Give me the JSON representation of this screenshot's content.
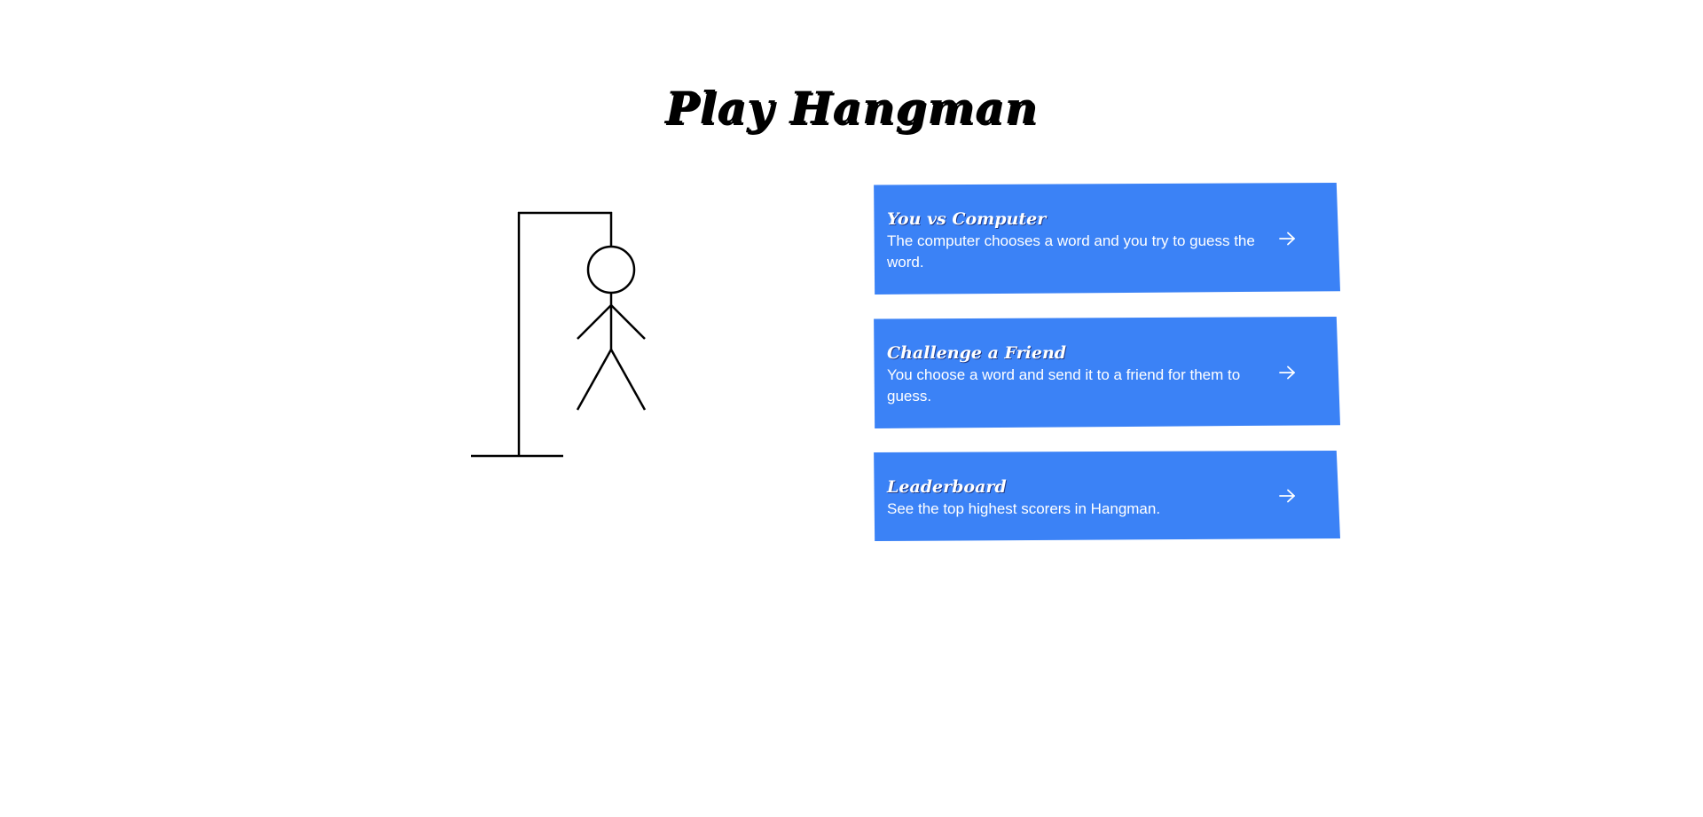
{
  "header": {
    "title": "Play Hangman"
  },
  "illustration": {
    "icon": "hangman-figure-icon"
  },
  "menu": {
    "items": [
      {
        "title": "You vs Computer",
        "description": "The computer chooses a word and you try to guess the word.",
        "icon": "arrow-right-icon"
      },
      {
        "title": "Challenge a Friend",
        "description": "You choose a word and send it to a friend for them to guess.",
        "icon": "arrow-right-icon"
      },
      {
        "title": "Leaderboard",
        "description": "See the top highest scorers in Hangman.",
        "icon": "arrow-right-icon"
      }
    ]
  },
  "colors": {
    "card_background": "#3b82f6",
    "card_text": "#ffffff",
    "page_background": "#ffffff",
    "drawing_stroke": "#000000"
  }
}
